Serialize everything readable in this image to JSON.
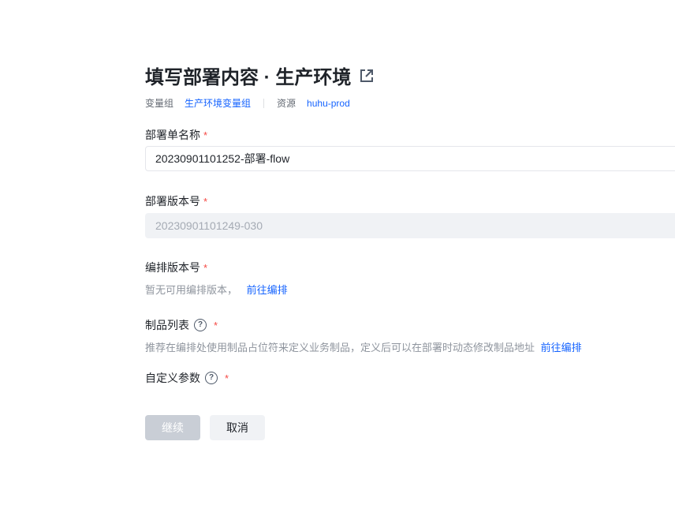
{
  "header": {
    "title": "填写部署内容 · 生产环境",
    "external_link_icon": "external-link-icon",
    "variable_group_label": "变量组",
    "variable_group_value": "生产环境变量组",
    "resource_label": "资源",
    "resource_value": "huhu-prod"
  },
  "form": {
    "deploy_name": {
      "label": "部署单名称",
      "required": "*",
      "value": "20230901101252-部署-flow"
    },
    "deploy_version": {
      "label": "部署版本号",
      "required": "*",
      "value": "20230901101249-030"
    },
    "orchestration_version": {
      "label": "编排版本号",
      "required": "*",
      "empty_text": "暂无可用编排版本，",
      "link": "前往编排"
    },
    "artifact_list": {
      "label": "制品列表",
      "required": "*",
      "help": "?",
      "hint": "推荐在编排处使用制品占位符来定义业务制品，定义后可以在部署时动态修改制品地址",
      "link": "前往编排"
    },
    "custom_params": {
      "label": "自定义参数",
      "required": "*",
      "help": "?"
    }
  },
  "actions": {
    "continue_label": "继续",
    "cancel_label": "取消"
  },
  "colors": {
    "accent": "#1664ff",
    "required": "#f54a45",
    "disabled_button": "#c9ced6"
  }
}
